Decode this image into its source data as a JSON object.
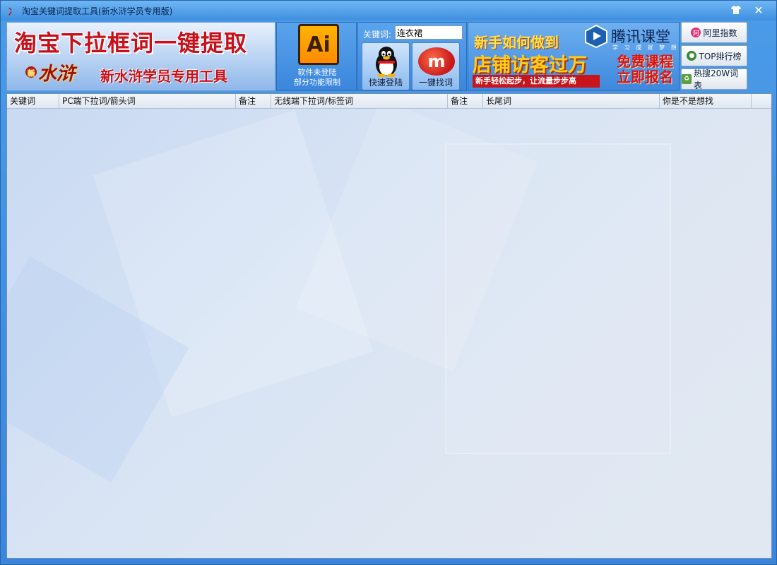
{
  "window": {
    "title": "淘宝关键词提取工具(新水浒学员专用版)",
    "app_icon": "shuihu-icon",
    "skin_icon": "shirt-icon",
    "close_icon": "close-icon"
  },
  "banner": {
    "title": "淘宝下拉框词一键提取",
    "logo_text": "水浒",
    "logo_badge": "新",
    "subtitle": "新水浒学员专用工具"
  },
  "ai_panel": {
    "icon_text": "Ai",
    "status_line1": "软件未登陆",
    "status_line2": "部分功能限制"
  },
  "keyword": {
    "label": "关键词:",
    "value": "连衣裙",
    "quick_login_label": "快速登陆",
    "find_words_label": "一键找词",
    "find_icon_text": "m"
  },
  "ad": {
    "line1": "新手如何做到",
    "line2": "店铺访客过万",
    "line3": "新手轻松起步，让流量步步高",
    "brand": "腾讯课堂",
    "slogan": "学 习 成 就 梦 想",
    "cta_line1": "免费课程",
    "cta_line2": "立即报名"
  },
  "side_buttons": {
    "ali_index": "阿里指数",
    "top_rank": "TOP排行榜",
    "hot_search": "热搜20W词表",
    "ali_icon_text": "阿"
  },
  "grid": {
    "columns": [
      "关键词",
      "PC端下拉词/箭头词",
      "备注",
      "无线端下拉词/标签词",
      "备注",
      "长尾词",
      "你是不是想找"
    ]
  }
}
